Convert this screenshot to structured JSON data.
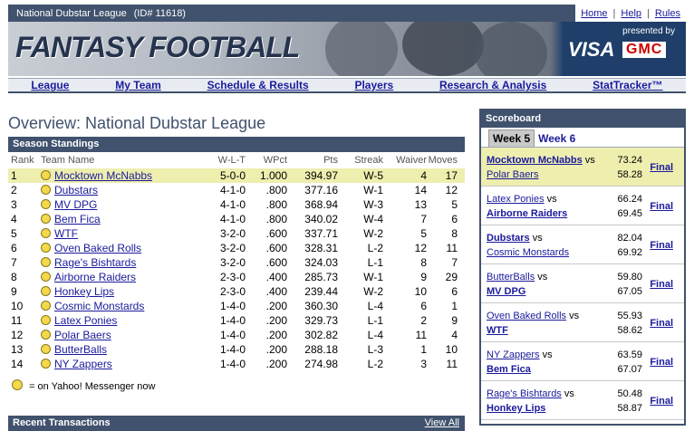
{
  "topbar": {
    "league": "National Dubstar League",
    "league_id": "(ID# 11618)"
  },
  "toplinks": [
    "Home",
    "Help",
    "Rules"
  ],
  "banner": {
    "logo": "FANTASY FOOTBALL",
    "presented_by": "presented by",
    "sponsor1": "VISA",
    "sponsor2": "GMC"
  },
  "nav": [
    "League",
    "My Team",
    "Schedule & Results",
    "Players",
    "Research & Analysis",
    "StatTracker™"
  ],
  "page_title": "Overview: National Dubstar League",
  "standings": {
    "title": "Season Standings",
    "columns": [
      "Rank",
      "Team Name",
      "W-L-T",
      "WPct",
      "Pts",
      "Streak",
      "Waiver",
      "Moves"
    ],
    "rows": [
      [
        "1",
        "Mocktown McNabbs",
        "5-0-0",
        "1.000",
        "394.97",
        "W-5",
        "4",
        "17"
      ],
      [
        "2",
        "Dubstars",
        "4-1-0",
        ".800",
        "377.16",
        "W-1",
        "14",
        "12"
      ],
      [
        "3",
        "MV DPG",
        "4-1-0",
        ".800",
        "368.94",
        "W-3",
        "13",
        "5"
      ],
      [
        "4",
        "Bem Fica",
        "4-1-0",
        ".800",
        "340.02",
        "W-4",
        "7",
        "6"
      ],
      [
        "5",
        "WTF",
        "3-2-0",
        ".600",
        "337.71",
        "W-2",
        "5",
        "8"
      ],
      [
        "6",
        "Oven Baked Rolls",
        "3-2-0",
        ".600",
        "328.31",
        "L-2",
        "12",
        "11"
      ],
      [
        "7",
        "Rage's Bishtards",
        "3-2-0",
        ".600",
        "324.03",
        "L-1",
        "8",
        "7"
      ],
      [
        "8",
        "Airborne Raiders",
        "2-3-0",
        ".400",
        "285.73",
        "W-1",
        "9",
        "29"
      ],
      [
        "9",
        "Honkey Lips",
        "2-3-0",
        ".400",
        "239.44",
        "W-2",
        "10",
        "6"
      ],
      [
        "10",
        "Cosmic Monstards",
        "1-4-0",
        ".200",
        "360.30",
        "L-4",
        "6",
        "1"
      ],
      [
        "11",
        "Latex Ponies",
        "1-4-0",
        ".200",
        "329.73",
        "L-1",
        "2",
        "9"
      ],
      [
        "12",
        "Polar Baers",
        "1-4-0",
        ".200",
        "302.82",
        "L-4",
        "11",
        "4"
      ],
      [
        "13",
        "ButterBalls",
        "1-4-0",
        ".200",
        "288.18",
        "L-3",
        "1",
        "10"
      ],
      [
        "14",
        "NY Zappers",
        "1-4-0",
        ".200",
        "274.98",
        "L-2",
        "3",
        "11"
      ]
    ],
    "note": "= on Yahoo! Messenger now"
  },
  "recent": {
    "title": "Recent Transactions",
    "view_all": "View All"
  },
  "scoreboard": {
    "title": "Scoreboard",
    "active_week": "Week 5",
    "other_week": "Week 6",
    "vs": "vs",
    "final": "Final",
    "games": [
      {
        "t1": "Mocktown McNabbs",
        "s1": "73.24",
        "t2": "Polar Baers",
        "s2": "58.28",
        "w": 1
      },
      {
        "t1": "Latex Ponies",
        "s1": "66.24",
        "t2": "Airborne Raiders",
        "s2": "69.45",
        "w": 2
      },
      {
        "t1": "Dubstars",
        "s1": "82.04",
        "t2": "Cosmic Monstards",
        "s2": "69.92",
        "w": 1
      },
      {
        "t1": "ButterBalls",
        "s1": "59.80",
        "t2": "MV DPG",
        "s2": "67.05",
        "w": 2
      },
      {
        "t1": "Oven Baked Rolls",
        "s1": "55.93",
        "t2": "WTF",
        "s2": "58.62",
        "w": 2
      },
      {
        "t1": "NY Zappers",
        "s1": "63.59",
        "t2": "Bem Fica",
        "s2": "67.07",
        "w": 2
      },
      {
        "t1": "Rage's Bishtards",
        "s1": "50.48",
        "t2": "Honkey Lips",
        "s2": "58.87",
        "w": 2
      }
    ]
  },
  "colors": {
    "header": "#40526d",
    "highlight": "#eeeeaf",
    "link": "#1a1a9c"
  }
}
